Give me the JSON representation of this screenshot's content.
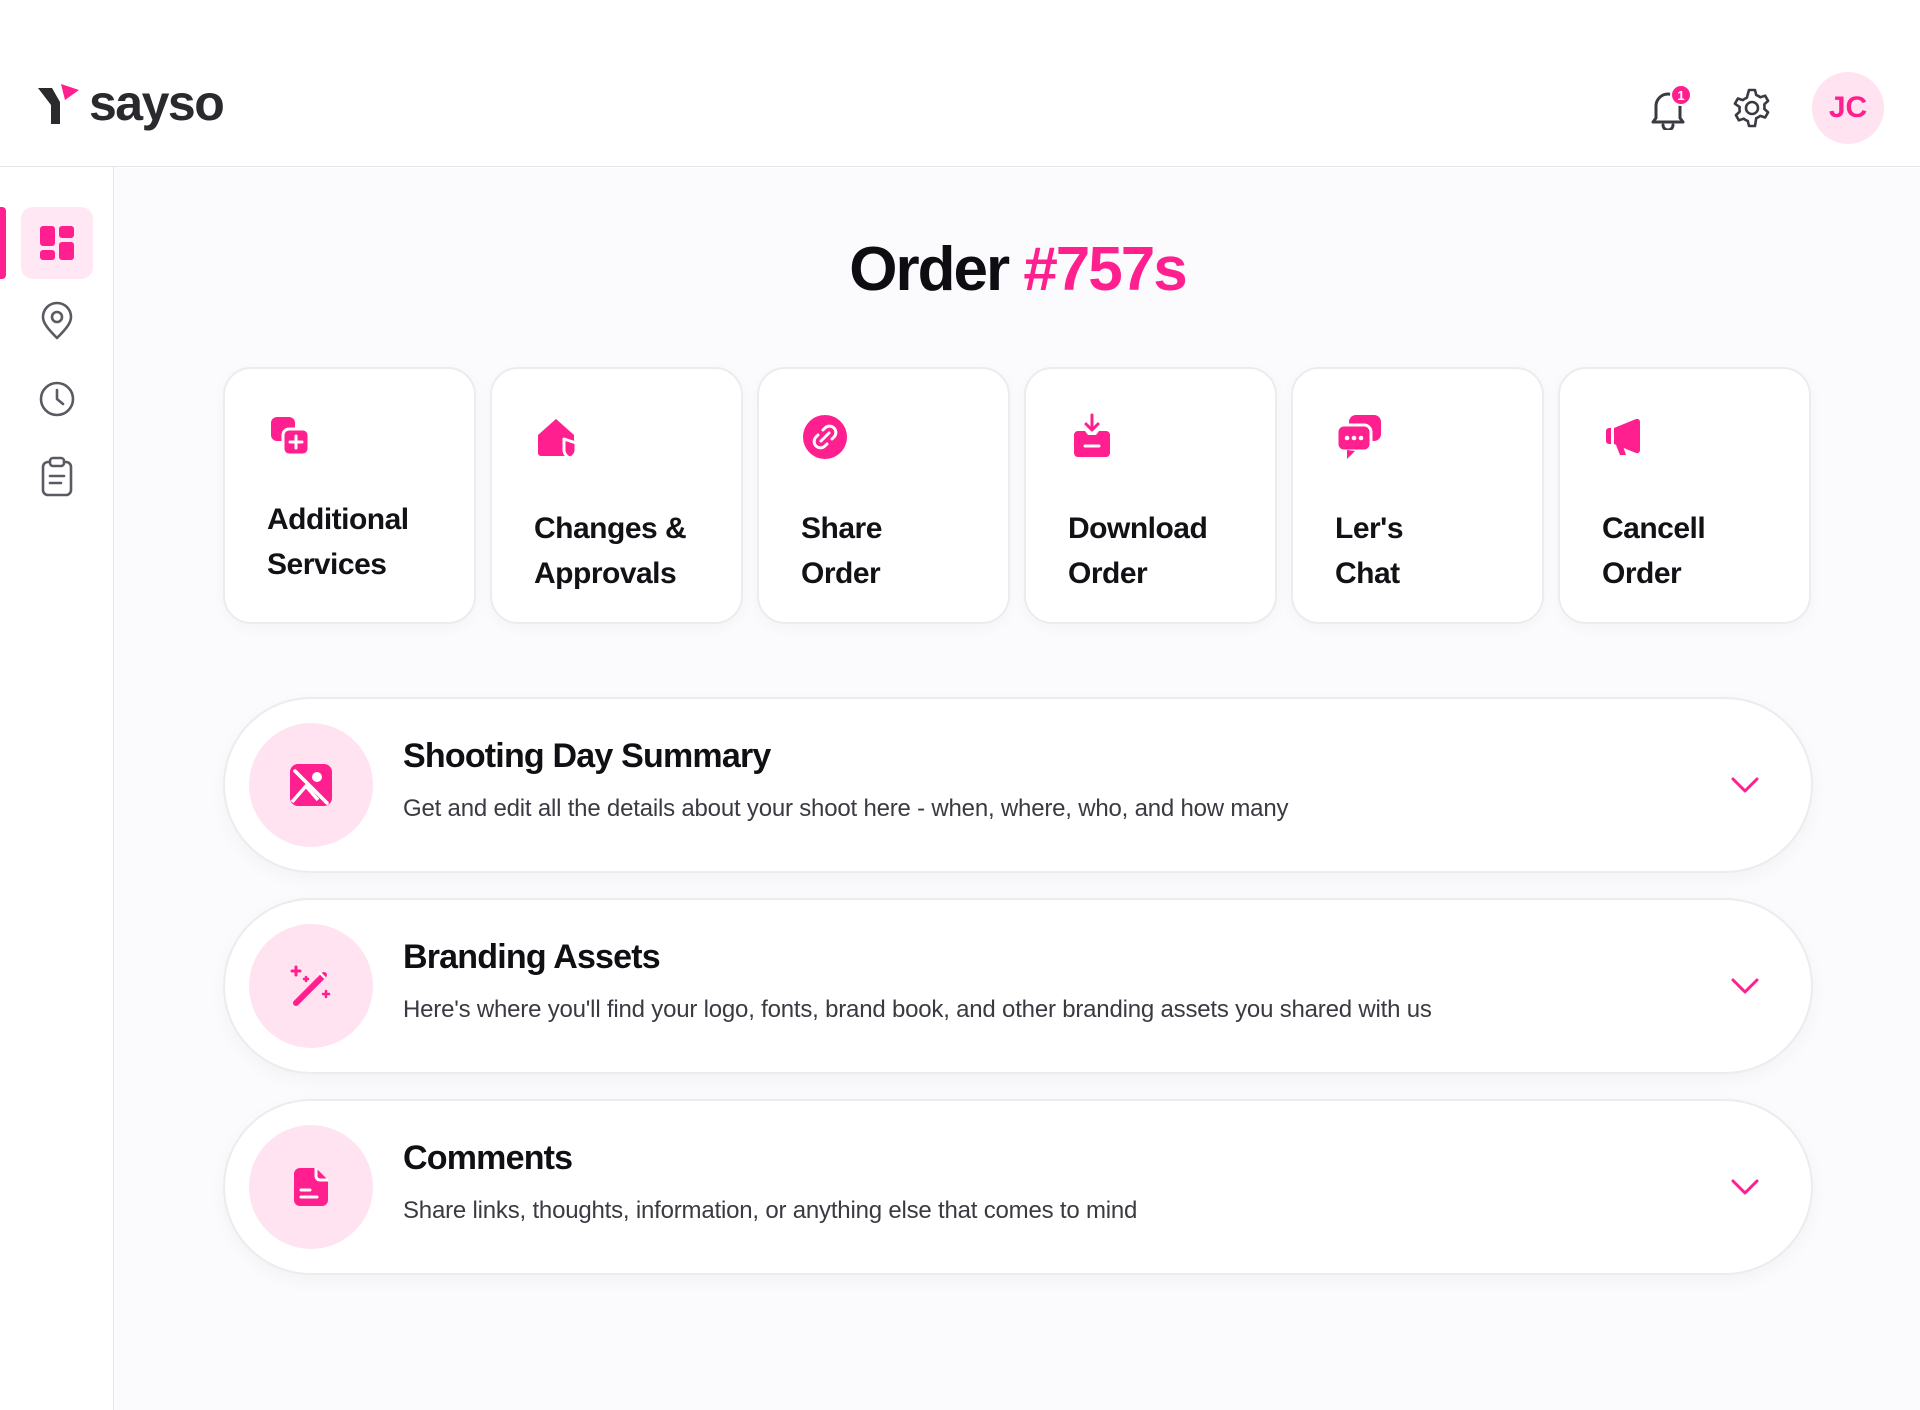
{
  "brand": {
    "name": "sayso",
    "accent": "#ff1f8e",
    "accent_soft": "#ffe3f1"
  },
  "header": {
    "notifications_count": "1",
    "avatar_initials": "JC",
    "icons": [
      "bell-icon",
      "gear-icon"
    ]
  },
  "sidebar": {
    "items": [
      {
        "icon": "dashboard-icon",
        "active": true
      },
      {
        "icon": "location-pin-icon",
        "active": false
      },
      {
        "icon": "clock-icon",
        "active": false
      },
      {
        "icon": "clipboard-icon",
        "active": false
      }
    ]
  },
  "page": {
    "title_prefix": "Order ",
    "order_number": "#757s"
  },
  "actions": [
    {
      "icon": "additional-services-icon",
      "line1": "Additional",
      "line2": "Services"
    },
    {
      "icon": "changes-approvals-icon",
      "line1": "Changes &",
      "line2": "Approvals"
    },
    {
      "icon": "share-link-icon",
      "line1": "Share",
      "line2": "Order"
    },
    {
      "icon": "download-icon",
      "line1": "Download",
      "line2": "Order"
    },
    {
      "icon": "chat-icon",
      "line1": "Ler's",
      "line2": "Chat"
    },
    {
      "icon": "megaphone-icon",
      "line1": "Cancell",
      "line2": "Order"
    }
  ],
  "sections": [
    {
      "icon": "image-icon",
      "title": "Shooting Day Summary",
      "description": "Get and edit all the details about your shoot here - when, where, who, and how many"
    },
    {
      "icon": "magic-wand-icon",
      "title": "Branding Assets",
      "description": "Here's where you'll find your logo, fonts, brand book, and other branding assets you shared with us"
    },
    {
      "icon": "document-icon",
      "title": "Comments",
      "description": "Share links, thoughts, information, or anything else that comes to mind"
    }
  ]
}
